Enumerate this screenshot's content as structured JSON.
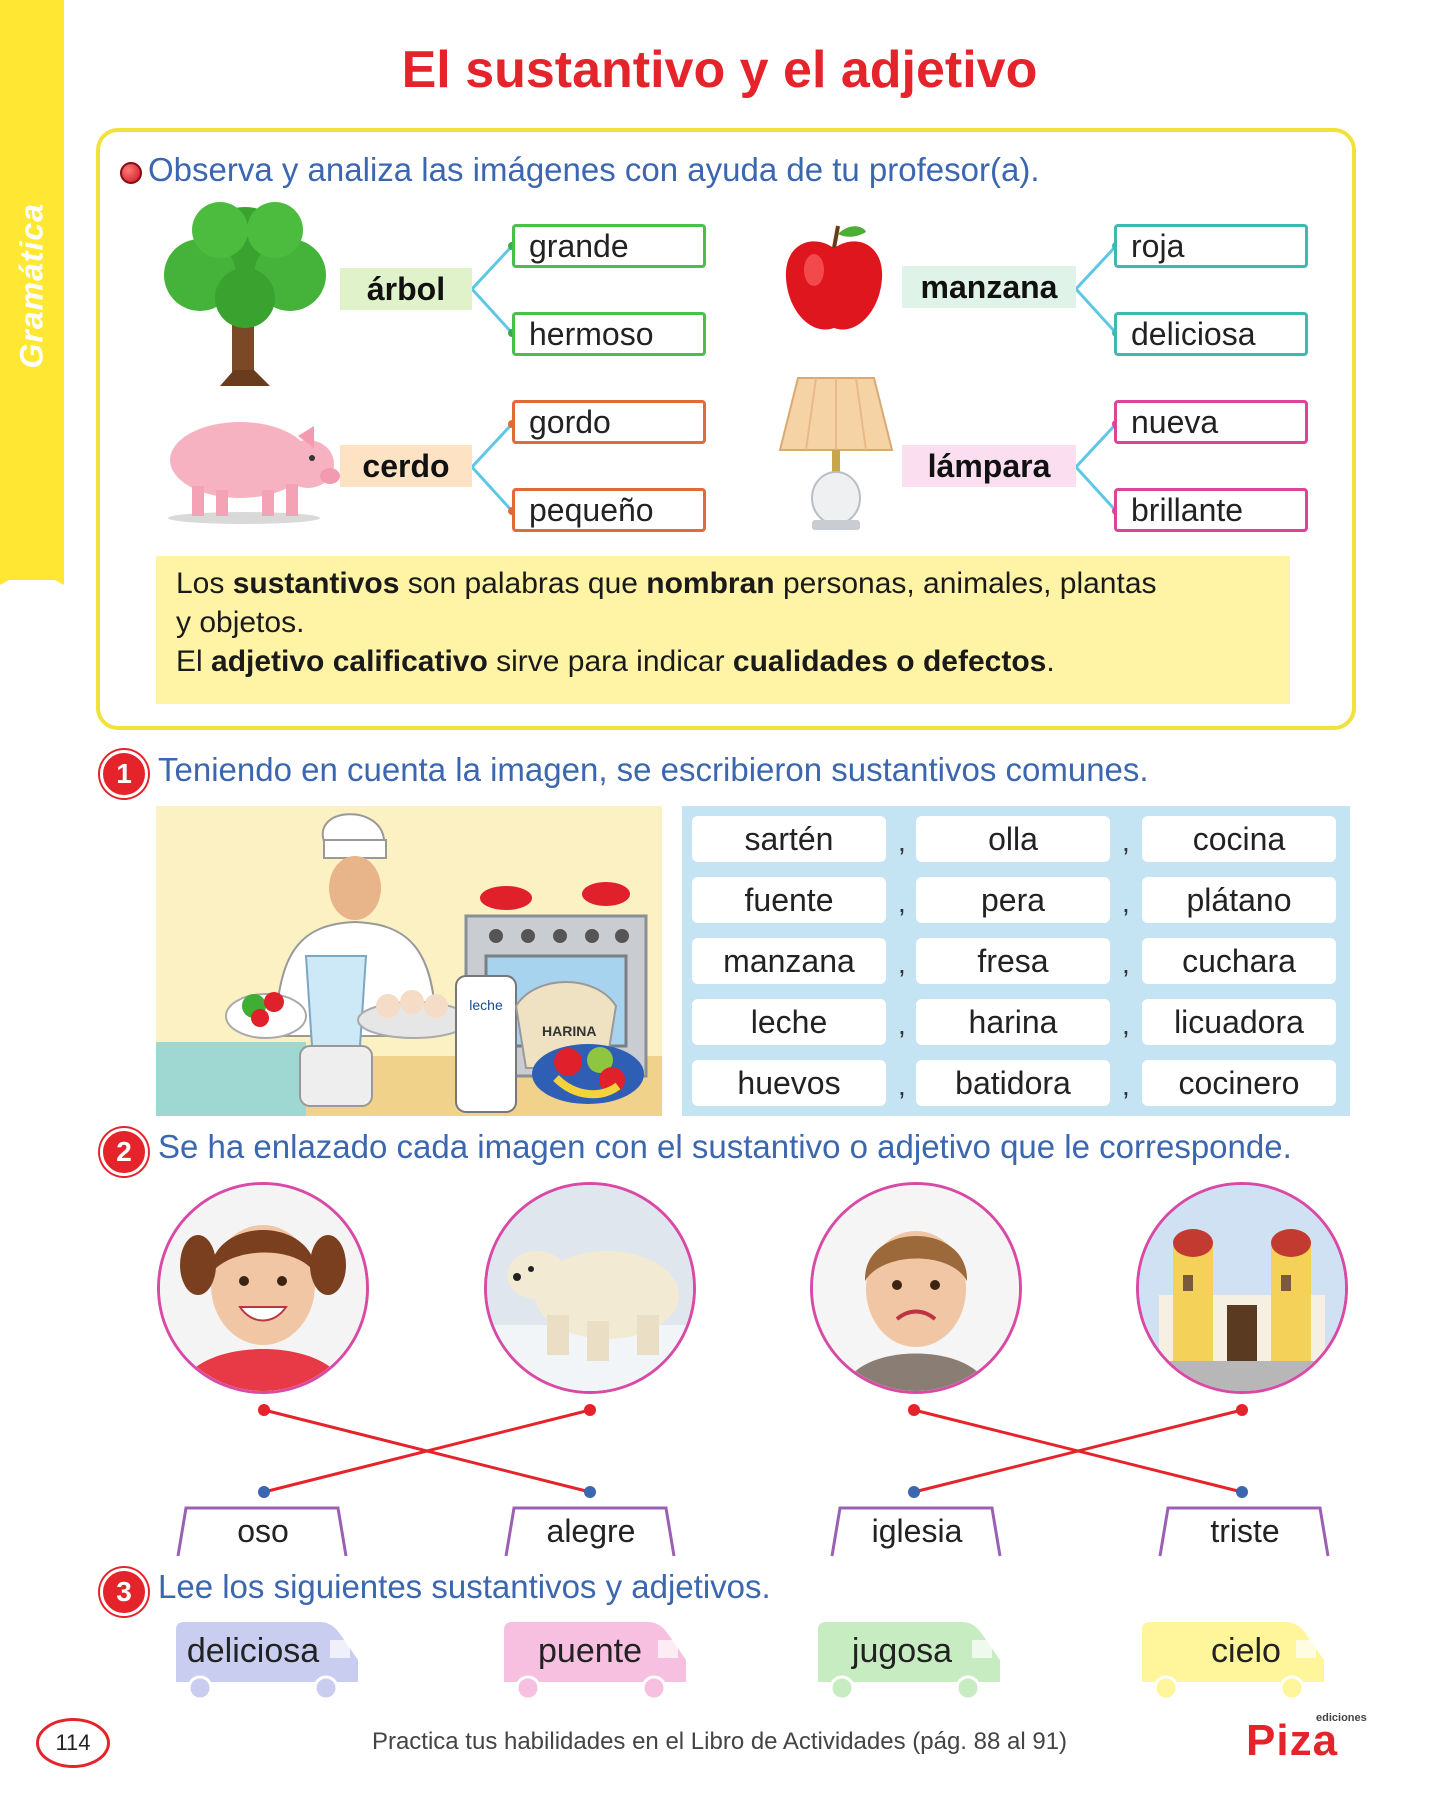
{
  "side_tab": "Gramática",
  "title": "El sustantivo y el adjetivo",
  "intro": {
    "instruction": "Observa y analiza las imágenes con ayuda de tu profesor(a).",
    "groups": [
      {
        "noun": "árbol",
        "adjectives": [
          "grande",
          "hermoso"
        ]
      },
      {
        "noun": "manzana",
        "adjectives": [
          "roja",
          "deliciosa"
        ]
      },
      {
        "noun": "cerdo",
        "adjectives": [
          "gordo",
          "pequeño"
        ]
      },
      {
        "noun": "lámpara",
        "adjectives": [
          "nueva",
          "brillante"
        ]
      }
    ],
    "rule": {
      "l1a": "Los ",
      "l1b": "sustantivos",
      "l1c": " son palabras que ",
      "l1d": "nombran",
      "l1e": " personas, animales, plantas",
      "l2": "y objetos.",
      "l3a": "El ",
      "l3b": "adjetivo calificativo",
      "l3c": " sirve para indicar ",
      "l3d": "cualidades o defectos",
      "l3e": "."
    }
  },
  "ex1": {
    "number": "1",
    "instruction": "Teniendo en cuenta la imagen, se escribieron sustantivos comunes.",
    "image_labels": {
      "milk": "leche",
      "flour": "HARINA"
    },
    "words": [
      [
        "sartén",
        "olla",
        "cocina"
      ],
      [
        "fuente",
        "pera",
        "plátano"
      ],
      [
        "manzana",
        "fresa",
        "cuchara"
      ],
      [
        "leche",
        "harina",
        "licuadora"
      ],
      [
        "huevos",
        "batidora",
        "cocinero"
      ]
    ],
    "separator": ","
  },
  "ex2": {
    "number": "2",
    "instruction": "Se ha enlazado cada imagen con el sustantivo o adjetivo que le corresponde.",
    "labels": [
      "oso",
      "alegre",
      "iglesia",
      "triste"
    ]
  },
  "ex3": {
    "number": "3",
    "instruction": "Lee los siguientes sustantivos y adjetivos.",
    "words": [
      "deliciosa",
      "puente",
      "jugosa",
      "cielo"
    ]
  },
  "colors": {
    "title": "#e5232b",
    "instruction": "#3b66b0",
    "frame": "#f0e23a",
    "adj_tree": "#4cbe4c",
    "adj_apple": "#3fb8b0",
    "adj_pig": "#e06a3a",
    "adj_lamp": "#e0429a",
    "truck_1": "#c9cdf0",
    "truck_2": "#f7bfe0",
    "truck_3": "#c8ecc2",
    "truck_4": "#fff59a"
  },
  "footer": {
    "page": "114",
    "text": "Practica tus habilidades en el Libro de Actividades (pág. 88 al 91)",
    "logo": "Piza",
    "logo_small": "ediciones"
  }
}
